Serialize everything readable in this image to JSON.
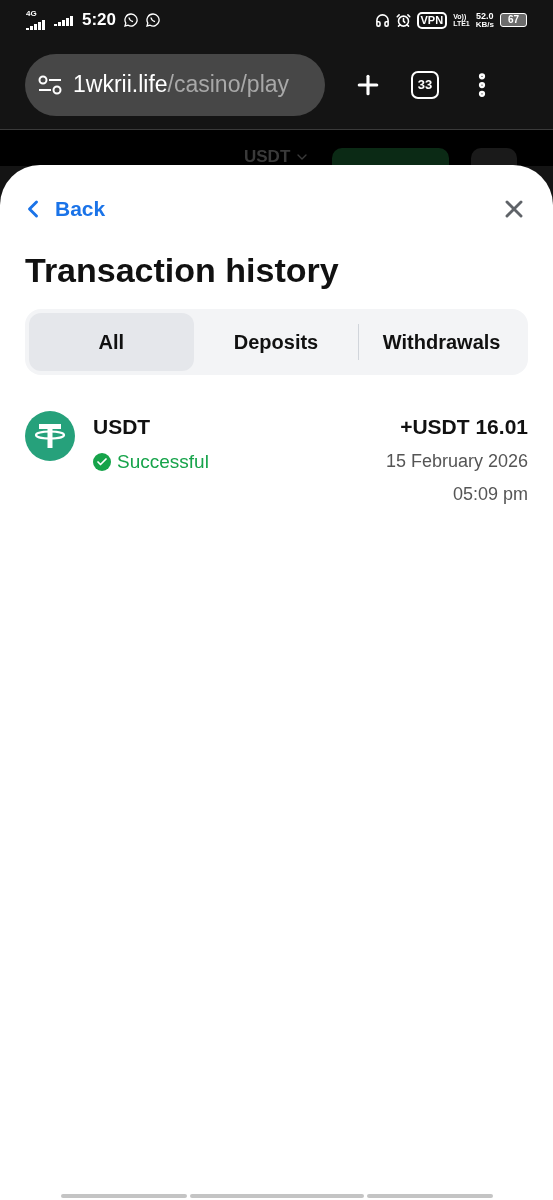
{
  "status_bar": {
    "network": "4G",
    "time": "5:20",
    "vpn": "VPN",
    "volte_top": "Vo))",
    "volte_bottom": "LTE1",
    "speed_value": "52.0",
    "speed_unit": "KB/s",
    "battery": "67"
  },
  "browser": {
    "url_host": "1wkrii.life",
    "url_path": "/casino/play",
    "tab_count": "33"
  },
  "backdrop": {
    "currency": "USDT"
  },
  "sheet": {
    "back": "Back",
    "title": "Transaction history",
    "tabs": [
      {
        "label": "All",
        "selected": true
      },
      {
        "label": "Deposits",
        "selected": false
      },
      {
        "label": "Withdrawals",
        "selected": false
      }
    ],
    "transactions": [
      {
        "currency": "USDT",
        "status": "Successful",
        "kind": "success",
        "amount": "+USDT 16.01",
        "date": "15 February 2026",
        "time": "05:09 pm"
      }
    ]
  }
}
